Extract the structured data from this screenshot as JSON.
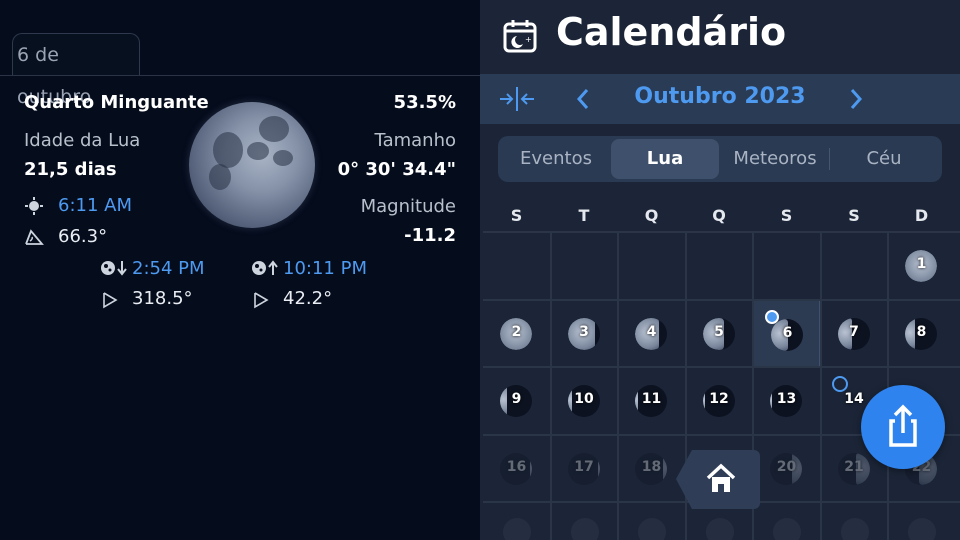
{
  "left": {
    "date_tab": "6 de outubro",
    "phase_name": "Quarto Minguante",
    "illumination": "53.5%",
    "age_label": "Idade da Lua",
    "age_value": "21,5 dias",
    "size_label": "Tamanho",
    "size_value": "0° 30' 34.4\"",
    "transit_time": "6:11 AM",
    "transit_altitude": "66.3°",
    "magnitude_label": "Magnitude",
    "magnitude_value": "-11.2",
    "moonset_time": "2:54 PM",
    "moonset_azimuth": "318.5°",
    "moonrise_time": "10:11 PM",
    "moonrise_azimuth": "42.2°"
  },
  "right": {
    "title": "Calendário",
    "month": "Outubro 2023",
    "tabs": [
      "Eventos",
      "Lua",
      "Meteoros",
      "Céu"
    ],
    "active_tab": "Lua",
    "weekdays": [
      "S",
      "T",
      "Q",
      "Q",
      "S",
      "S",
      "D"
    ],
    "days": [
      {
        "n": "1",
        "row": 0,
        "col": 6,
        "lit": 0.97,
        "side": "right"
      },
      {
        "n": "2",
        "row": 1,
        "col": 0,
        "lit": 0.92,
        "side": "left"
      },
      {
        "n": "3",
        "row": 1,
        "col": 1,
        "lit": 0.85,
        "side": "left"
      },
      {
        "n": "4",
        "row": 1,
        "col": 2,
        "lit": 0.76,
        "side": "left"
      },
      {
        "n": "5",
        "row": 1,
        "col": 3,
        "lit": 0.66,
        "side": "left"
      },
      {
        "n": "6",
        "row": 1,
        "col": 4,
        "lit": 0.54,
        "side": "left",
        "selected": true
      },
      {
        "n": "7",
        "row": 1,
        "col": 5,
        "lit": 0.43,
        "side": "left"
      },
      {
        "n": "8",
        "row": 1,
        "col": 6,
        "lit": 0.32,
        "side": "left"
      },
      {
        "n": "9",
        "row": 2,
        "col": 0,
        "lit": 0.22,
        "side": "left"
      },
      {
        "n": "10",
        "row": 2,
        "col": 1,
        "lit": 0.14,
        "side": "left"
      },
      {
        "n": "11",
        "row": 2,
        "col": 2,
        "lit": 0.08,
        "side": "left"
      },
      {
        "n": "12",
        "row": 2,
        "col": 3,
        "lit": 0.03,
        "side": "left"
      },
      {
        "n": "13",
        "row": 2,
        "col": 4,
        "lit": 0.01,
        "side": "left"
      },
      {
        "n": "14",
        "row": 2,
        "col": 5,
        "lit": 0.0,
        "side": "left",
        "new_moon": true
      },
      {
        "n": "16",
        "row": 3,
        "col": 0,
        "lit": 0.03,
        "side": "right",
        "faded": true
      },
      {
        "n": "17",
        "row": 3,
        "col": 1,
        "lit": 0.07,
        "side": "right",
        "faded": true
      },
      {
        "n": "18",
        "row": 3,
        "col": 2,
        "lit": 0.12,
        "side": "right",
        "faded": true
      },
      {
        "n": "20",
        "row": 3,
        "col": 4,
        "lit": 0.3,
        "side": "right",
        "faded": true
      },
      {
        "n": "21",
        "row": 3,
        "col": 5,
        "lit": 0.45,
        "side": "right",
        "faded": true
      },
      {
        "n": "22",
        "row": 3,
        "col": 6,
        "lit": 0.55,
        "side": "right",
        "faded": true
      }
    ]
  },
  "colors": {
    "accent": "#4d9af0",
    "panel": "#1b2537",
    "background": "#050c1c",
    "share": "#2f83ee"
  }
}
